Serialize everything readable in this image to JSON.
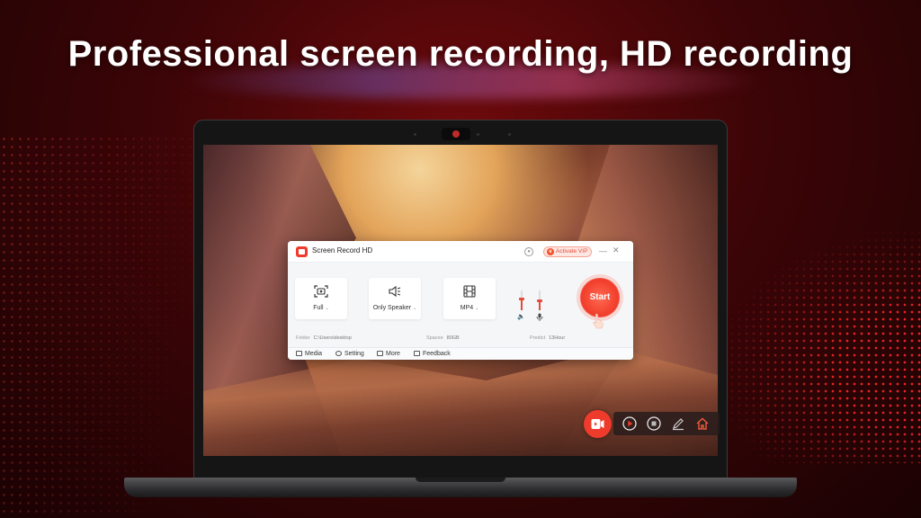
{
  "headline": "Professional screen recording, HD recording",
  "app": {
    "title": "Screen Record HD",
    "activate_vip": "Activate VIP",
    "modes": [
      {
        "label": "Full",
        "icon": "screen-capture-icon"
      },
      {
        "label": "Only Speaker",
        "icon": "speaker-icon"
      },
      {
        "label": "MP4",
        "icon": "film-icon"
      }
    ],
    "start_label": "Start",
    "folder_label": "Folder",
    "folder_value": "C:\\Users\\desktop",
    "space_label": "Spacee",
    "space_value": "80GB",
    "predict_label": "Predict",
    "predict_value": "13Hour",
    "speaker_level": 0.55,
    "mic_level": 0.45,
    "bottom_menu": [
      "Media",
      "Setting",
      "More",
      "Feedback"
    ]
  },
  "floating_toolbar": [
    "record-icon",
    "play-icon",
    "stop-icon",
    "pen-icon",
    "home-icon"
  ],
  "colors": {
    "accent": "#ee3b2b",
    "background": "#3d0507"
  }
}
